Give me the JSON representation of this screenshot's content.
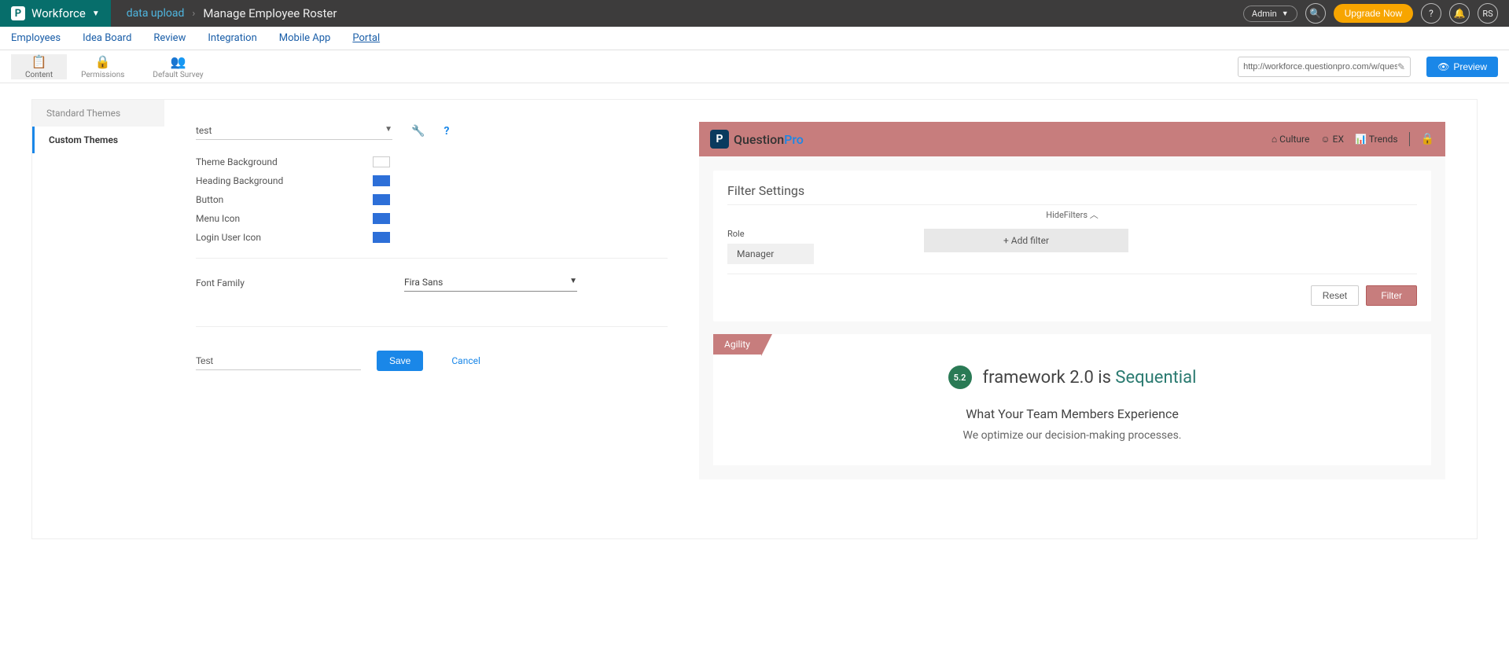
{
  "topbar": {
    "brand": "Workforce",
    "breadcrumb_link": "data upload",
    "breadcrumb_current": "Manage Employee Roster",
    "admin_label": "Admin",
    "upgrade_label": "Upgrade Now",
    "user_initials": "RS"
  },
  "primary_nav": {
    "items": [
      "Employees",
      "Idea Board",
      "Review",
      "Integration",
      "Mobile App",
      "Portal"
    ],
    "active": "Portal"
  },
  "toolbar": {
    "items": [
      "Content",
      "Permissions",
      "Default Survey"
    ],
    "url": "http://workforce.questionpro.com/w/quest",
    "preview_label": "Preview"
  },
  "tabs": {
    "standard": "Standard Themes",
    "custom": "Custom Themes"
  },
  "form": {
    "theme_name": "test",
    "rows": {
      "theme_bg": "Theme Background",
      "heading_bg": "Heading Background",
      "button": "Button",
      "menu_icon": "Menu Icon",
      "login_icon": "Login User Icon"
    },
    "font_label": "Font Family",
    "font_value": "Fira Sans",
    "name_value": "Test",
    "save_label": "Save",
    "cancel_label": "Cancel"
  },
  "preview": {
    "logo_q": "Question",
    "logo_pro": "Pro",
    "nav": {
      "culture": "Culture",
      "ex": "EX",
      "trends": "Trends"
    },
    "filter_title": "Filter Settings",
    "hide_label": "HideFilters",
    "role_label": "Role",
    "role_value": "Manager",
    "add_filter": "+ Add filter",
    "reset": "Reset",
    "filter_btn": "Filter",
    "tag": "Agility",
    "score": "5.2",
    "headline_a": "framework 2.0 is ",
    "headline_b": "Sequential",
    "sub1": "What Your Team Members Experience",
    "sub2": "We optimize our decision-making processes."
  }
}
